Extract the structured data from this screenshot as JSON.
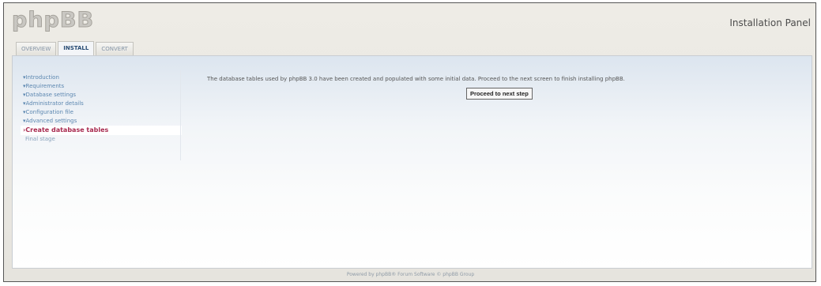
{
  "header": {
    "logo_text": "phpBB",
    "panel_title": "Installation Panel"
  },
  "tabs": [
    {
      "label": "Overview",
      "active": false
    },
    {
      "label": "Install",
      "active": true
    },
    {
      "label": "Convert",
      "active": false
    }
  ],
  "menu": {
    "items": [
      {
        "label": "Introduction",
        "state": "done"
      },
      {
        "label": "Requirements",
        "state": "done"
      },
      {
        "label": "Database settings",
        "state": "done"
      },
      {
        "label": "Administrator details",
        "state": "done"
      },
      {
        "label": "Configuration file",
        "state": "done"
      },
      {
        "label": "Advanced settings",
        "state": "done"
      },
      {
        "label": "Create database tables",
        "state": "active"
      },
      {
        "label": "Final stage",
        "state": "future"
      }
    ]
  },
  "content": {
    "message": "The database tables used by phpBB 3.0 have been created and populated with some initial data. Proceed to the next screen to finish installing phpBB.",
    "proceed_label": "Proceed to next step"
  },
  "footer": {
    "text": "Powered by phpBB® Forum Software © phpBB Group"
  },
  "colors": {
    "link": "#5c87b0",
    "active": "#a82a4f",
    "tab_active_text": "#284c74"
  }
}
